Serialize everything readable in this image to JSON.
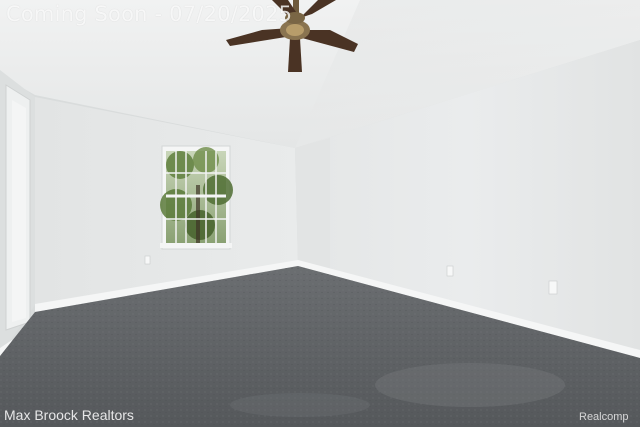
{
  "watermark": {
    "status_text": "Coming Soon - 07/20/2025",
    "agency": "Max Broock Realtors",
    "site": "Realcomp"
  },
  "colors": {
    "wall": "#e6e8e8",
    "ceiling": "#eeefef",
    "carpet": "#5d6063",
    "trim": "#f3f4f4",
    "fan_blade": "#4a3324",
    "foliage": "#5e7d3c"
  },
  "scene": {
    "fixture": "ceiling-fan-icon",
    "window": "window-icon"
  }
}
